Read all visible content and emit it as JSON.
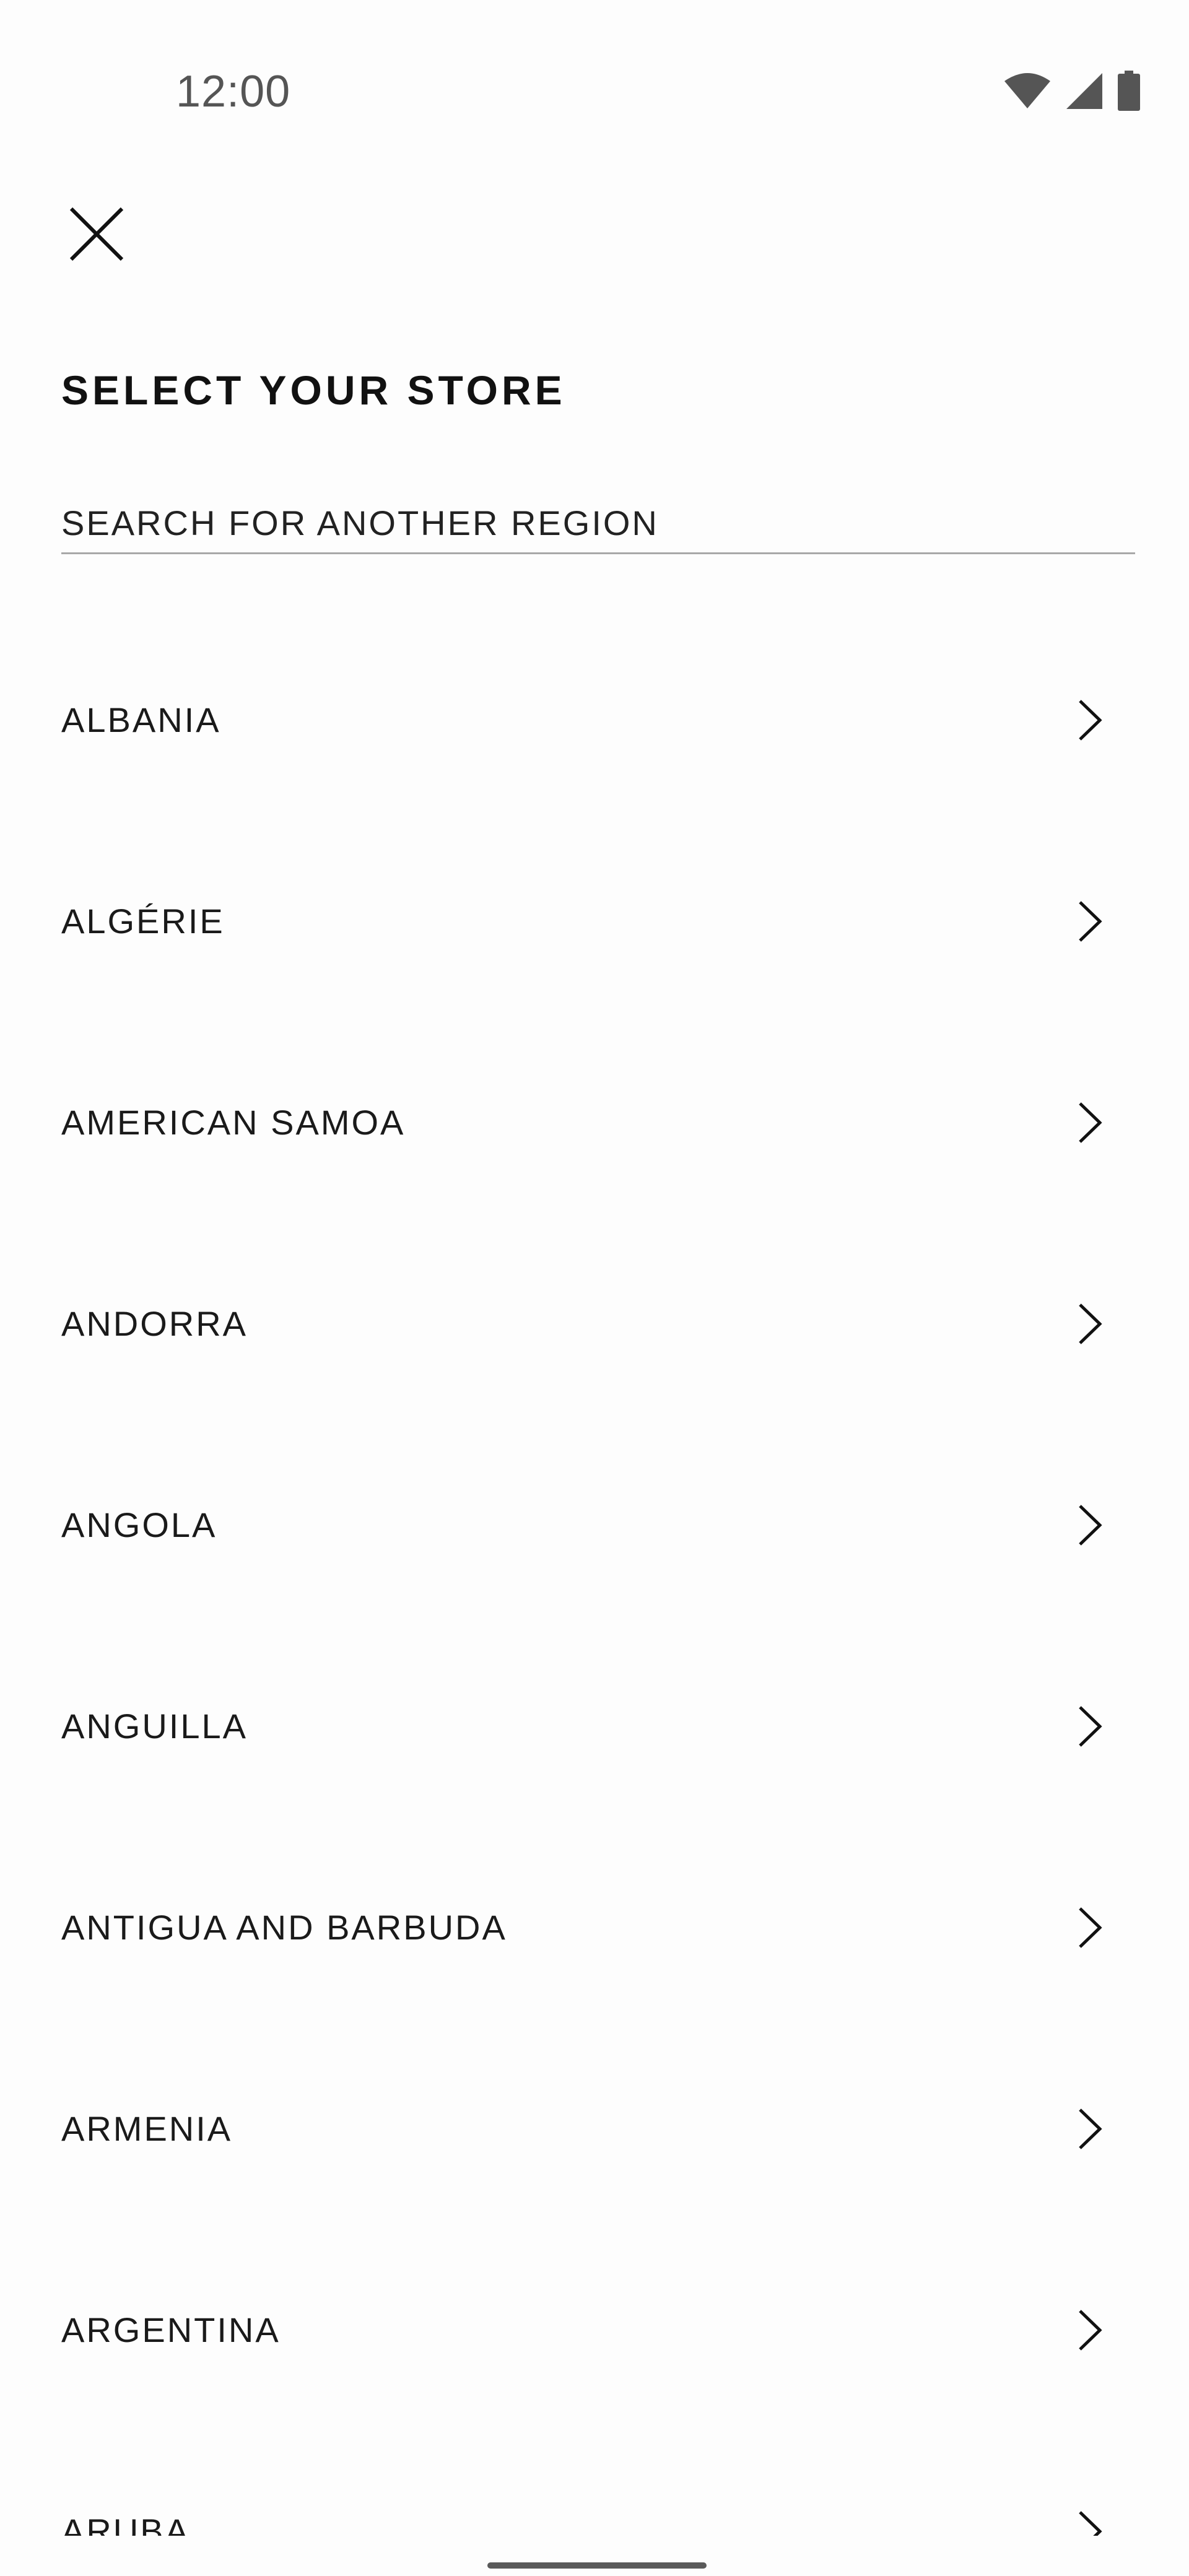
{
  "status_bar": {
    "time": "12:00",
    "icons": [
      "wifi-icon",
      "cellular-signal-icon",
      "battery-icon"
    ]
  },
  "header": {
    "close_icon": "close-icon",
    "title": "SELECT YOUR STORE"
  },
  "search": {
    "placeholder": "SEARCH FOR ANOTHER REGION",
    "value": ""
  },
  "regions": [
    {
      "label": "ALBANIA"
    },
    {
      "label": "ALGÉRIE"
    },
    {
      "label": "AMERICAN SAMOA"
    },
    {
      "label": "ANDORRA"
    },
    {
      "label": "ANGOLA"
    },
    {
      "label": "ANGUILLA"
    },
    {
      "label": "ANTIGUA AND BARBUDA"
    },
    {
      "label": "ARMENIA"
    },
    {
      "label": "ARGENTINA"
    },
    {
      "label": "ARUBA"
    }
  ],
  "colors": {
    "background": "#fdfdfd",
    "text": "#111111",
    "divider": "#a8a8a8",
    "status_text": "#555555"
  }
}
